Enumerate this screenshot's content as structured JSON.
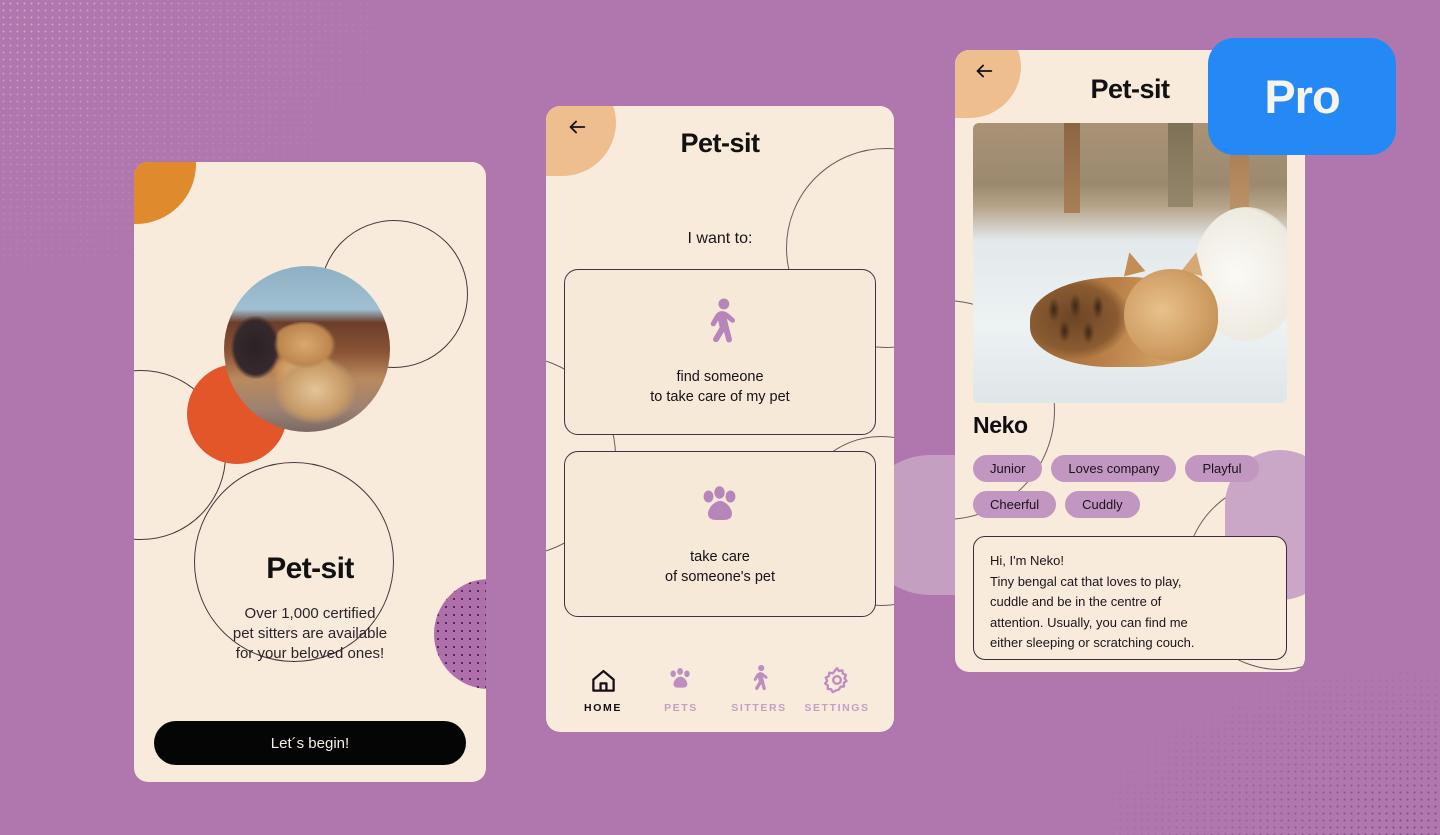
{
  "background": {
    "color": "#AF77AD"
  },
  "badge": {
    "label": "Pro",
    "color": "#2589F5"
  },
  "phone1": {
    "name": "onboarding-screen",
    "title": "Pet-sit",
    "subtitle": "Over 1,000 certified\npet sitters are available\nfor your beloved ones!",
    "subtitle_lines": [
      "Over 1,000 certified",
      "pet sitters are available",
      "for your beloved ones!"
    ],
    "cta_label": "Let´s begin!",
    "cta_color": "#050505",
    "decor": {
      "orange_blob": "#DF8B2D",
      "red_circle": "#E2562A",
      "dotted_circle": "#AF6FAB"
    },
    "photo_alt": "ginger maine coon cat lying down"
  },
  "phone2": {
    "name": "choose-role-screen",
    "title": "Pet-sit",
    "back_icon": "arrow-left-icon",
    "prompt": "I want to:",
    "options": [
      {
        "id": "find-someone",
        "icon": "walking-person-icon",
        "lines": [
          "find someone",
          "to take care of my pet"
        ]
      },
      {
        "id": "take-care",
        "icon": "paw-icon",
        "lines": [
          "take care",
          "of someone's pet"
        ]
      }
    ],
    "nav": [
      {
        "label": "Home",
        "icon": "home-icon",
        "active": true
      },
      {
        "label": "Pets",
        "icon": "paw-icon",
        "active": false
      },
      {
        "label": "Sitters",
        "icon": "walking-person-icon",
        "active": false
      },
      {
        "label": "Settings",
        "icon": "gear-icon",
        "active": false
      }
    ],
    "accent": "#B685BA",
    "back_blob_color": "#EFBE8E"
  },
  "phone3": {
    "name": "pet-profile-screen",
    "title": "Pet-sit",
    "back_icon": "arrow-left-icon",
    "pet_name": "Neko",
    "photo_alt": "sleeping bengal kitten on white bed",
    "tags": [
      "Junior",
      "Loves company",
      "Playful",
      "Cheerful",
      "Cuddly"
    ],
    "tag_color": "#C196C1",
    "bio_lines": [
      "Hi, I'm Neko!",
      "Tiny bengal cat that loves to play,",
      "cuddle and be in the centre of",
      "attention. Usually, you can find me",
      "either sleeping or scratching couch."
    ]
  }
}
